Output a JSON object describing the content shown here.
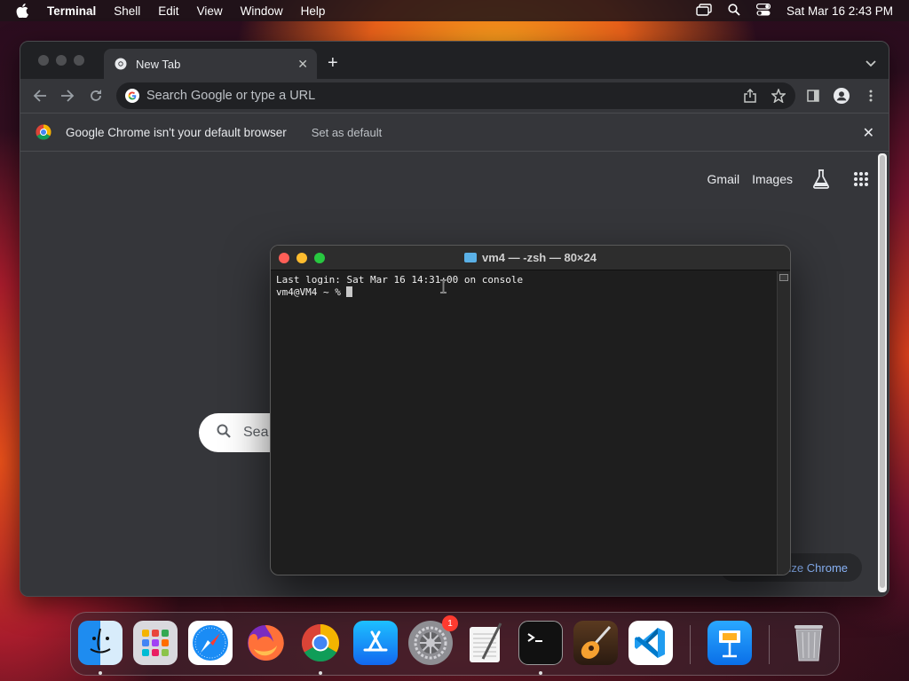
{
  "menubar": {
    "app_name": "Terminal",
    "items": [
      "Shell",
      "Edit",
      "View",
      "Window",
      "Help"
    ],
    "clock": "Sat Mar 16  2:43 PM"
  },
  "chrome": {
    "tab_title": "New Tab",
    "omnibox_placeholder": "Search Google or type a URL",
    "infobar_message": "Google Chrome isn't your default browser",
    "infobar_action": "Set as default",
    "links": {
      "gmail": "Gmail",
      "images": "Images"
    },
    "search_partial": "Sea",
    "customize_label": "ize Chrome"
  },
  "terminal": {
    "title": "vm4 — -zsh — 80×24",
    "line1": "Last login: Sat Mar 16 14:31:00 on console",
    "prompt": "vm4@VM4 ~ % "
  },
  "dock": {
    "apps": [
      "finder-icon",
      "launchpad-icon",
      "safari-icon",
      "firefox-icon",
      "chrome-icon",
      "app-store-icon",
      "system-settings-icon",
      "textedit-icon",
      "terminal-icon",
      "garageband-icon",
      "vscode-icon",
      "keynote-icon",
      "trash-icon"
    ],
    "settings_badge": "1"
  },
  "colors": {
    "chrome_bg": "#35363a",
    "terminal_bg": "#1e1e1e",
    "close_red": "#ff5f57",
    "minimize_yellow": "#febc2e",
    "zoom_green": "#28c840"
  }
}
